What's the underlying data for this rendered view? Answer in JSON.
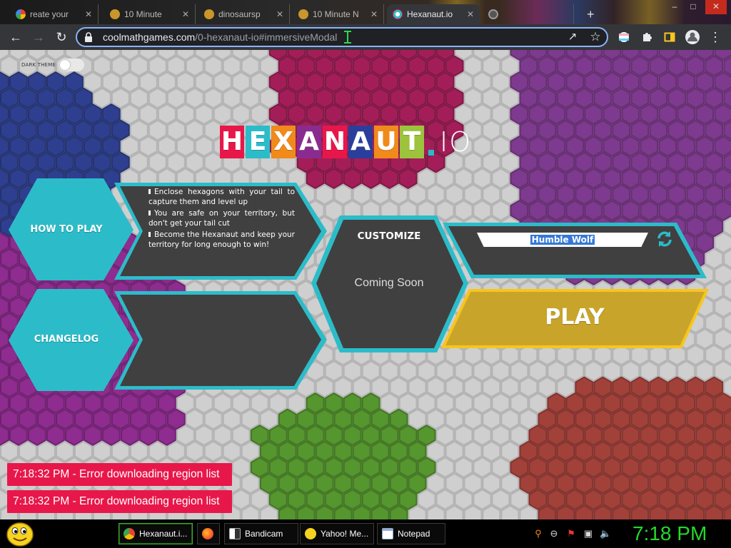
{
  "browser": {
    "tabs": [
      {
        "label": "reate your",
        "icon": "google-icon",
        "active": false
      },
      {
        "label": "10 Minute",
        "icon": "hamster-icon",
        "active": false
      },
      {
        "label": "dinosaursp",
        "icon": "hamster-icon",
        "active": false
      },
      {
        "label": "10 Minute N",
        "icon": "hamster-icon",
        "active": false
      },
      {
        "label": "Hexanaut.io",
        "icon": "hexanaut-icon",
        "active": true
      },
      {
        "label": "",
        "icon": "github-icon",
        "active": false
      }
    ],
    "new_tab": "+",
    "window_controls": {
      "minimize": "–",
      "maximize": "□",
      "close": "✕"
    },
    "url_host": "coolmathgames.com",
    "url_path": "/0-hexanaut-io#immersiveModal"
  },
  "page": {
    "dark_theme_label": "DARK THEME",
    "dark_theme_on": false,
    "logo": {
      "letters": [
        "H",
        "E",
        "X",
        "A",
        "N",
        "A",
        "U",
        "T"
      ],
      "letter_colors": [
        "#e8174a",
        "#2cbcc9",
        "#f08a1b",
        "#8a2c8f",
        "#e8174a",
        "#2a3f9c",
        "#f08a1b",
        "#9bc33c"
      ],
      "suffix": "IO"
    },
    "how_to_play": {
      "label": "HOW TO PLAY",
      "rules": [
        "Enclose hexagons with your tail to capture them and level up",
        "You are safe on your territory, but don't get your tail cut",
        "Become the Hexanaut and keep your territory for long enough to win!"
      ]
    },
    "changelog": {
      "label": "CHANGELOG"
    },
    "customize": {
      "title": "CUSTOMIZE",
      "status": "Coming Soon"
    },
    "nickname": "Humble Wolf",
    "play_label": "PLAY",
    "errors": [
      "7:18:32 PM - Error downloading region list",
      "7:18:32 PM - Error downloading region list"
    ],
    "colors": {
      "teal": "#2cbcc9",
      "panel": "#404040",
      "play": "#c8a52a",
      "play_border": "#f7c51e",
      "error": "#e8174a"
    }
  },
  "taskbar": {
    "tasks": [
      {
        "label": "Hexanaut.i...",
        "icon": "chrome-icon",
        "active": true
      },
      {
        "label": "",
        "icon": "firefox-icon",
        "active": false
      },
      {
        "label": "Bandicam",
        "icon": "bandicam-icon",
        "active": false
      },
      {
        "label": "Yahoo! Me...",
        "icon": "yahoo-messenger-icon",
        "active": false
      },
      {
        "label": "Notepad",
        "icon": "notepad-icon",
        "active": false
      }
    ],
    "clock": "7:18 PM"
  }
}
